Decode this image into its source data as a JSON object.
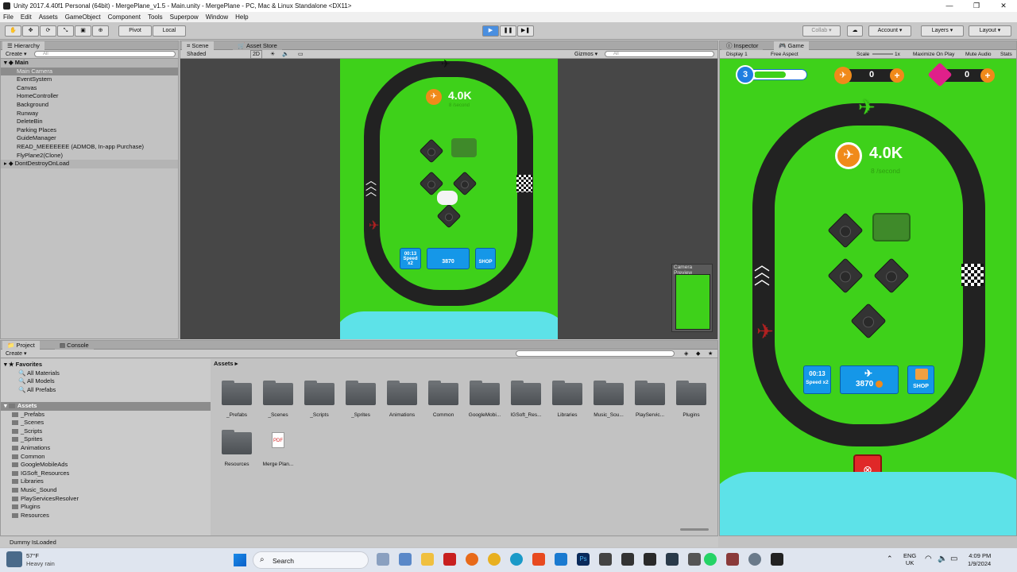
{
  "window": {
    "title": "Unity 2017.4.40f1 Personal (64bit) - MergePlane_v1.5 - Main.unity - MergePlane - PC, Mac & Linux Standalone <DX11>"
  },
  "menu": [
    "File",
    "Edit",
    "Assets",
    "GameObject",
    "Component",
    "Tools",
    "Superpow",
    "Window",
    "Help"
  ],
  "toolbar": {
    "pivot": "Pivot",
    "local": "Local",
    "collab": "Collab ▾",
    "account": "Account",
    "layers": "Layers",
    "layout": "Layout"
  },
  "hierarchy": {
    "tab": "Hierarchy",
    "create": "Create ▾",
    "search": "All",
    "scene": "Main",
    "items": [
      "Main Camera",
      "EventSystem",
      "Canvas",
      "HomeController",
      "Background",
      "Runway",
      "DeleteBin",
      "Parking Places",
      "GuideManager",
      "READ_MEEEEEEE (ADMOB, In-app Purchase)",
      "FlyPlane2(Clone)"
    ],
    "ddol": "DontDestroyOnLoad"
  },
  "scene": {
    "tab": "Scene",
    "asset_store": "Asset Store",
    "shaded": "Shaded",
    "mode2d": "2D",
    "gizmos": "Gizmos ▾",
    "search": "All",
    "camera_preview": "Camera Preview"
  },
  "game": {
    "inspector_tab": "Inspector",
    "tab": "Game",
    "display": "Display 1",
    "aspect": "Free Aspect",
    "scale_label": "Scale",
    "scale": "1x",
    "maximize": "Maximize On Play",
    "mute": "Mute Audio",
    "stats": "Stats",
    "level": "3",
    "coins_top": "0",
    "gems_top": "0",
    "coins": "4.0K",
    "rate": "8 /second",
    "speed_time": "00:13",
    "speed_label": "Speed x2",
    "buy_price": "3870",
    "shop": "SHOP"
  },
  "project": {
    "tab": "Project",
    "console": "Console",
    "create": "Create ▾",
    "favorites": "Favorites",
    "fav_items": [
      "All Materials",
      "All Models",
      "All Prefabs"
    ],
    "assets_root": "Assets",
    "tree": [
      "_Prefabs",
      "_Scenes",
      "_Scripts",
      "_Sprites",
      "Animations",
      "Common",
      "GoogleMobileAds",
      "IGSoft_Resources",
      "Libraries",
      "Music_Sound",
      "PlayServicesResolver",
      "Plugins",
      "Resources"
    ],
    "breadcrumb": "Assets ▸",
    "grid": [
      "_Prefabs",
      "_Scenes",
      "_Scripts",
      "_Sprites",
      "Animations",
      "Common",
      "GoogleMobi...",
      "IGSoft_Res...",
      "Libraries",
      "Music_Sou...",
      "PlayServic...",
      "Plugins",
      "Resources",
      "Merge Plan..."
    ]
  },
  "status": {
    "text": "Dummy IsLoaded"
  },
  "taskbar": {
    "temp": "57°F",
    "weather": "Heavy rain",
    "search": "Search",
    "lang1": "ENG",
    "lang2": "UK",
    "time": "4:09 PM",
    "date": "1/9/2024"
  },
  "colors": {
    "grass": "#3ed11a",
    "track": "#222222",
    "button": "#1597e8",
    "sky": "#5de2e8"
  }
}
